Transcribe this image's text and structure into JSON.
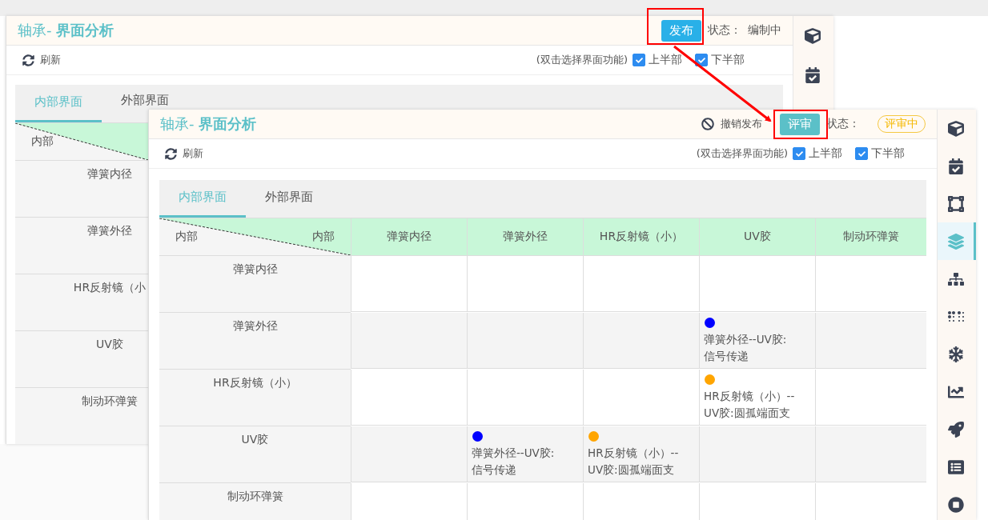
{
  "back_window": {
    "title": "轴承- **界面分析**",
    "action_button": "发布",
    "status_label": "状态：",
    "status": "编制中",
    "refresh": "刷新",
    "hint": "(双击选择界面功能)",
    "checkboxes": [
      {
        "label": "上半部",
        "checked": true
      },
      {
        "label": "下半部",
        "checked": true
      }
    ],
    "tabs": [
      {
        "label": "内部界面",
        "selected": true
      },
      {
        "label": "外部界面",
        "selected": false
      }
    ],
    "table": {
      "corner_left": "内部",
      "row_headers": [
        "弹簧内径",
        "弹簧外径",
        "HR反射镜（小",
        "UV胶",
        "制动环弹簧"
      ]
    },
    "sidebar": [
      {
        "selected": false
      },
      {
        "selected": false
      }
    ]
  },
  "front_window": {
    "title": "轴承- **界面分析**",
    "revoke_button": "撤销发布",
    "action_button": "评审",
    "status_label": "状态：",
    "status_badge": "评审中",
    "refresh": "刷新",
    "hint": "(双击选择界面功能)",
    "checkboxes": [
      {
        "label": "上半部",
        "checked": true
      },
      {
        "label": "下半部",
        "checked": true
      }
    ],
    "tabs": [
      {
        "label": "内部界面",
        "selected": true
      },
      {
        "label": "外部界面",
        "selected": false
      }
    ],
    "table": {
      "corner_left": "内部",
      "corner_right": "内部",
      "columns": [
        "弹簧内径",
        "弹簧外径",
        "HR反射镜（小）",
        "UV胶",
        "制动环弹簧"
      ],
      "rows": [
        {
          "header": "弹簧内径",
          "cells": [
            {},
            {},
            {},
            {},
            {}
          ]
        },
        {
          "header": "弹簧外径",
          "cells": [
            {},
            {},
            {},
            {
              "color": "#0000ff",
              "text": "弹簧外径--UV胶:信号传递"
            },
            {}
          ]
        },
        {
          "header": "HR反射镜（小）",
          "cells": [
            {},
            {},
            {},
            {
              "color": "#ffa500",
              "text": "HR反射镜（小）--UV胶:圆孤端面支"
            },
            {}
          ]
        },
        {
          "header": "UV胶",
          "cells": [
            {},
            {
              "color": "#0000ff",
              "text": "弹簧外径--UV胶:信号传递"
            },
            {
              "color": "#ffa500",
              "text": "HR反射镜（小）--UV胶:圆孤端面支"
            },
            {},
            {}
          ]
        },
        {
          "header": "制动环弹簧",
          "cells": [
            {},
            {},
            {},
            {},
            {}
          ]
        }
      ]
    },
    "sidebar": [
      {
        "selected": false
      },
      {
        "selected": false
      },
      {
        "selected": false
      },
      {
        "selected": true
      },
      {
        "selected": false
      },
      {
        "selected": false
      },
      {
        "selected": false
      },
      {
        "selected": false
      },
      {
        "selected": false
      },
      {
        "selected": false
      },
      {
        "selected": false
      }
    ]
  }
}
